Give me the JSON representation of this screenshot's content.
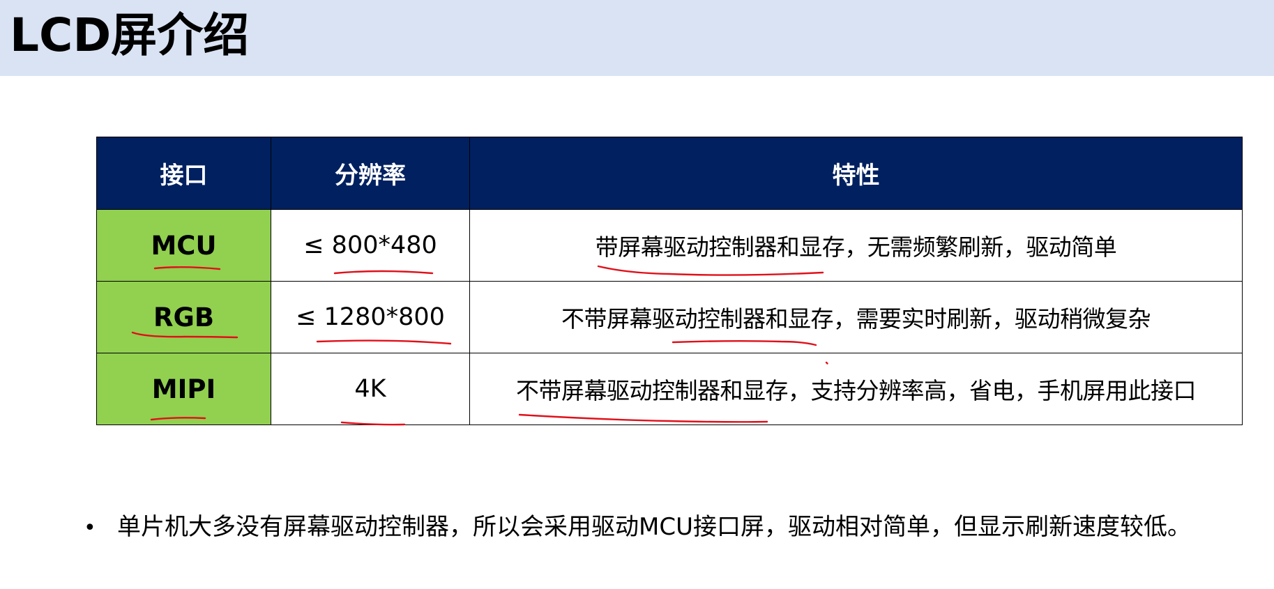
{
  "title": "LCD屏介绍",
  "table": {
    "headers": [
      "接口",
      "分辨率",
      "特性"
    ],
    "rows": [
      {
        "interface": "MCU",
        "resolution": "≤ 800*480",
        "feature": "带屏幕驱动控制器和显存，无需频繁刷新，驱动简单"
      },
      {
        "interface": "RGB",
        "resolution": "≤ 1280*800",
        "feature": "不带屏幕驱动控制器和显存，需要实时刷新，驱动稍微复杂"
      },
      {
        "interface": "MIPI",
        "resolution": "4K",
        "feature": "不带屏幕驱动控制器和显存，支持分辨率高，省电，手机屏用此接口"
      }
    ]
  },
  "bullet": {
    "marker": "•",
    "text": "单片机大多没有屏幕驱动控制器，所以会采用驱动MCU接口屏，驱动相对简单，但显示刷新速度较低。"
  },
  "colors": {
    "header_band": "#dae3f3",
    "table_header": "#002060",
    "interface_cell": "#92d050",
    "annotation": "#e0101a"
  }
}
